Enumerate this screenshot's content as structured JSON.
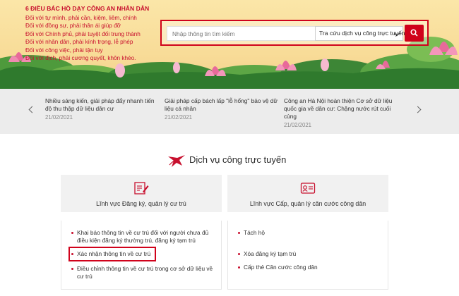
{
  "banner": {
    "title": "6 ĐIỀU BÁC HỒ DẠY CÔNG AN NHÂN DÂN",
    "lines": [
      "Đối với tự mình, phải cần, kiệm, liêm, chính",
      "Đối với đồng sự, phải thân ái giúp đỡ",
      "Đối với Chính phủ, phải tuyệt đối trung thành",
      "Đối với nhân dân, phải kính trọng, lễ phép",
      "Đối với công việc, phải tận tụy",
      "Đối với địch, phải cương quyết, khôn khéo."
    ]
  },
  "search": {
    "placeholder": "Nhập thông tin tìm kiếm",
    "selected_option": "Tra cứu dịch vụ công trực tuyến",
    "button_icon": "search-icon"
  },
  "news": [
    {
      "title": "Nhiều sáng kiến, giải pháp đẩy nhanh tiến độ thu thập dữ liệu dân cư",
      "date": "21/02/2021"
    },
    {
      "title": "Giải pháp cấp bách lấp \"lỗ hổng\" bảo vệ dữ liệu cá nhân",
      "date": "21/02/2021"
    },
    {
      "title": "Công an Hà Nội hoàn thiện Cơ sở dữ liệu quốc gia về dân cư: Chặng nước rút cuối cùng",
      "date": "21/02/2021"
    }
  ],
  "services": {
    "heading": "Dịch vụ công trực tuyến",
    "cards": [
      {
        "label": "Lĩnh vực Đăng ký, quản lý cư trú",
        "icon": "form-edit-icon"
      },
      {
        "label": "Lĩnh vực Cấp, quản lý căn cước công dân",
        "icon": "id-card-icon"
      }
    ],
    "left_items": [
      "Khai báo thông tin về cư trú đối với người chưa đủ điều kiện đăng ký thường trú, đăng ký tạm trú",
      "Xác nhận thông tin về cư trú",
      "Điều chỉnh thông tin về cư trú trong cơ sở dữ liệu về cư trú"
    ],
    "right_items": [
      "Tách hộ",
      "Xóa đăng ký tạm trú",
      "Cấp thẻ Căn cước công dân"
    ]
  },
  "colors": {
    "accent": "#d0021b",
    "banner_bg": "#fbe6a8",
    "news_bg": "#ececec",
    "card_bg": "#f1f1f1"
  }
}
